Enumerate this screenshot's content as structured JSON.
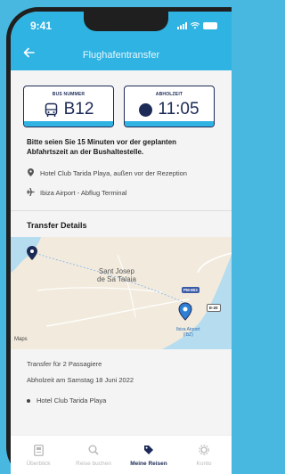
{
  "status": {
    "time": "9:41"
  },
  "header": {
    "title": "Flughafentransfer",
    "back_icon": "arrow-left-icon"
  },
  "cards": {
    "bus": {
      "label": "BUS NUMMER",
      "value": "B12",
      "icon": "bus-icon"
    },
    "pickup": {
      "label": "ABHOLZEIT",
      "value": "11:05",
      "icon": "dot-icon"
    }
  },
  "notice": "Bitte seien Sie 15 Minuten vor der geplanten Abfahrtszeit an der Bushaltestelle.",
  "locations": {
    "from": "Hotel Club Tarida Playa, außen vor der Rezeption",
    "to": "Ibiza Airport - Abflug Terminal"
  },
  "section_title": "Transfer Details",
  "map": {
    "place_label_line1": "Sant Josep",
    "place_label_line2": "de Sa Talaia",
    "brand": "Maps",
    "airport_line1": "Ibiza Airport",
    "airport_line2": "(IBZ)",
    "road1": "PM-803",
    "road2": "E-20"
  },
  "details": {
    "passengers": "Transfer für 2 Passagiere",
    "pickup_date": "Abholzeit am Samstag 18 Juni 2022",
    "hotel": "Hotel Club Tarida Playa"
  },
  "tabs": [
    {
      "label": "Überblick",
      "icon": "overview-icon"
    },
    {
      "label": "Reise buchen",
      "icon": "search-icon"
    },
    {
      "label": "Meine Reisen",
      "icon": "tag-icon",
      "active": true
    },
    {
      "label": "Konto",
      "icon": "gear-icon"
    }
  ],
  "colors": {
    "accent": "#2fb3e3",
    "navy": "#1c2a57",
    "background": "#48b8e0"
  }
}
